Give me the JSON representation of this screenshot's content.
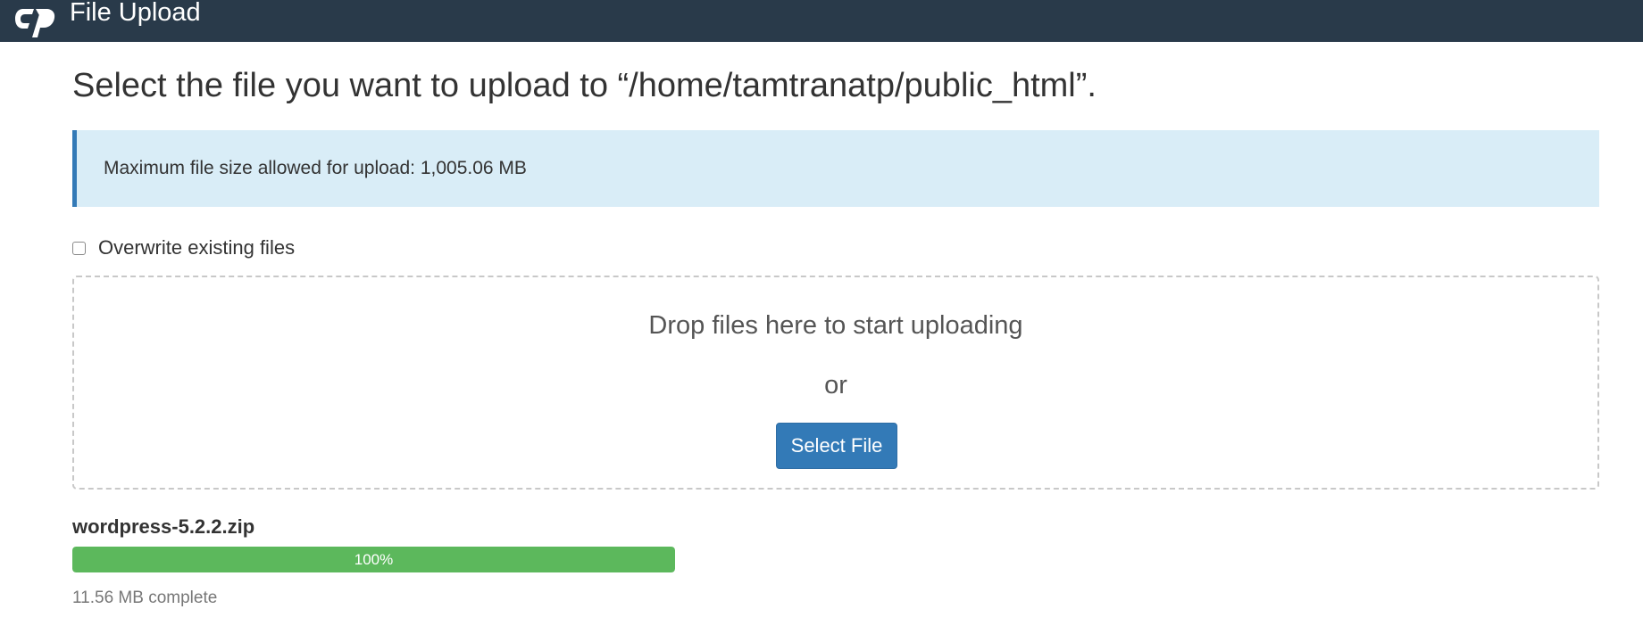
{
  "header": {
    "title": "File Upload",
    "logo_icon": "cpanel-logo-icon",
    "background": "#293a4a"
  },
  "main": {
    "title": "Select the file you want to upload to “/home/tamtranatp/public_html”.",
    "alert": {
      "text": "Maximum file size allowed for upload: 1,005.06 MB",
      "background": "#d9edf7",
      "border": "#337ab7"
    },
    "overwrite": {
      "label": "Overwrite existing files",
      "checked": false
    },
    "dropzone": {
      "drop_text": "Drop files here to start uploading",
      "or_text": "or",
      "button_label": "Select File",
      "button_color": "#337ab7"
    },
    "upload": {
      "file_name": "wordpress-5.2.2.zip",
      "progress_label": "100%",
      "progress_value": 1.0,
      "progress_color": "#5cb85c",
      "status": "11.56 MB complete"
    }
  }
}
